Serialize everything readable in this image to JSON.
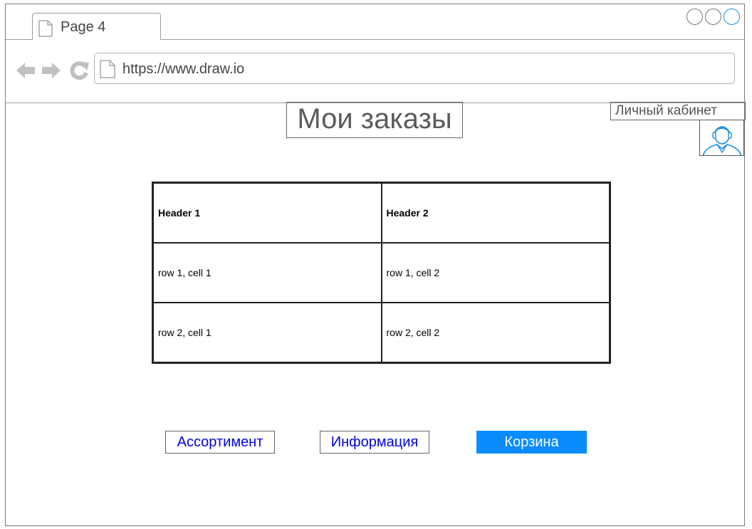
{
  "browser": {
    "tab_title": "Page 4",
    "url": "https://www.draw.io",
    "accent_color": "#1a8fe0",
    "icons": [
      "page-icon",
      "back-arrow-icon",
      "forward-arrow-icon",
      "reload-icon"
    ]
  },
  "page": {
    "title": "Мои заказы",
    "account_label": "Личный кабинет"
  },
  "table": {
    "headers": [
      "Header 1",
      "Header 2"
    ],
    "rows": [
      [
        "row 1, cell 1",
        "row 1, cell 2"
      ],
      [
        "row 2, cell 1",
        "row 2, cell 2"
      ]
    ]
  },
  "buttons": {
    "assortment": "Ассортимент",
    "info": "Информация",
    "cart": "Корзина",
    "primary_color": "#0a8cff",
    "link_color": "#0000e0"
  }
}
